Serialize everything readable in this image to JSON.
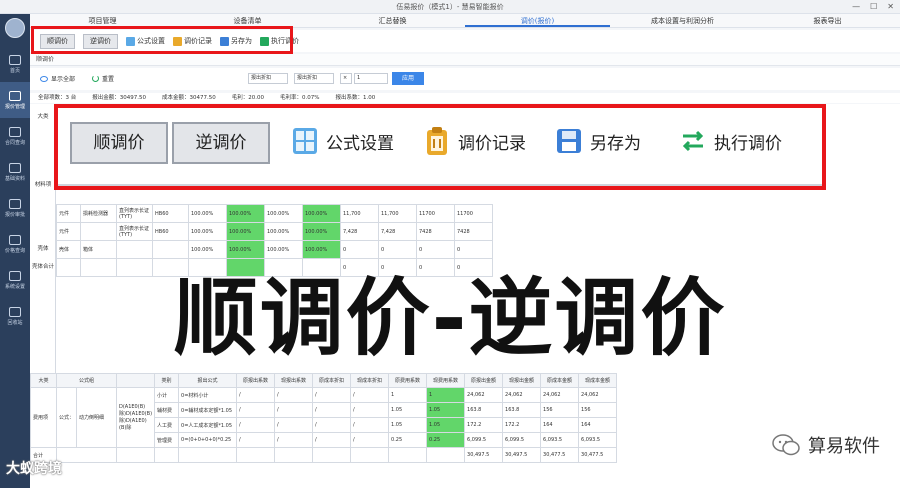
{
  "window": {
    "title": "伍易报价（模式1）- 慧易智能报价",
    "min": "—",
    "max": "☐",
    "close": "✕"
  },
  "sidebar": {
    "items": [
      {
        "label": "首页"
      },
      {
        "label": "报价管理"
      },
      {
        "label": "合同查询"
      },
      {
        "label": "基础资料"
      },
      {
        "label": "报价审批"
      },
      {
        "label": "价格查询"
      },
      {
        "label": "系统设置"
      },
      {
        "label": "回收站"
      }
    ]
  },
  "top_tabs": [
    "项目管理",
    "设备清单",
    "汇总替换",
    "调价(报价)",
    "成本设置与利润分析",
    "报表导出"
  ],
  "toolbar_small": {
    "forward": "顺调价",
    "reverse": "逆调价",
    "formula": "公式设置",
    "record": "调价记录",
    "save_as": "另存为",
    "execute": "执行调价"
  },
  "section_strip": "顺调价",
  "filter_row": {
    "show_all": "显示全部",
    "reset": "重置",
    "select1": "报出折扣",
    "select2": "报出折扣",
    "select3": "×",
    "input_value": "1",
    "apply": "应用"
  },
  "summary": {
    "items": [
      "全部项数：3 台",
      "报出金额：30497.50",
      "成本金额：30477.50",
      "毛利：20.00",
      "毛利率：0.07%",
      "报出系数：1.00"
    ]
  },
  "left_col": [
    "大类",
    "材料项",
    "壳体",
    "壳体合计"
  ],
  "upper_table": {
    "rows": [
      [
        "元件",
        "损耗检测器",
        "直列表示长证(TYT)",
        "HB60",
        "100.00%",
        "100.00%",
        "100.00%",
        "100.00%",
        "11,700",
        "11,700",
        "11700",
        "11700"
      ],
      [
        "元件",
        "",
        "直列表示长证(TYT)",
        "HB60",
        "100.00%",
        "100.00%",
        "100.00%",
        "100.00%",
        "7,428",
        "7,428",
        "7428",
        "7428"
      ],
      [
        "壳体",
        "箱体",
        "",
        "",
        "100.00%",
        "100.00%",
        "100.00%",
        "100.00%",
        "0",
        "0",
        "0",
        "0"
      ],
      [
        "",
        "",
        "",
        "",
        "",
        "",
        "",
        "",
        "0",
        "0",
        "0",
        "0"
      ]
    ]
  },
  "zoom_toolbar": {
    "forward": "顺调价",
    "reverse": "逆调价",
    "formula": "公式设置",
    "record": "调价记录",
    "save_as": "另存为",
    "execute": "执行调价"
  },
  "overlay_title": "顺调价-逆调价",
  "lower_table": {
    "headers": [
      "大类",
      "公式组",
      "",
      "类别",
      "报出公式",
      "原报出系数",
      "现报出系数",
      "原成本折扣",
      "现成本折扣",
      "原费用系数",
      "现费用系数",
      "原报出金额",
      "现报出金额",
      "原成本金额",
      "现成本金额"
    ],
    "rows": [
      [
        "费用项",
        "公式：",
        "动力倒明细",
        "D(A1E0(B)除)D(A1E0(B)除)D(A1E0)(B)除",
        "小计",
        "0=材料小计",
        "/",
        "/",
        "/",
        "/",
        "1",
        "1",
        "24,062",
        "24,062",
        "24,062",
        "24,062"
      ],
      [
        "",
        "",
        "",
        "",
        "辅材费",
        "0=辅材成本定额*1.05",
        "/",
        "/",
        "/",
        "/",
        "1.05",
        "1.05",
        "163.8",
        "163.8",
        "156",
        "156"
      ],
      [
        "",
        "",
        "",
        "",
        "人工费",
        "0=人工成本定额*1.05",
        "/",
        "/",
        "/",
        "/",
        "1.05",
        "1.05",
        "172.2",
        "172.2",
        "164",
        "164"
      ],
      [
        "",
        "",
        "",
        "",
        "管理费",
        "0=(0+0+0+0)*0.25",
        "/",
        "/",
        "/",
        "/",
        "0.25",
        "0.25",
        "6,099.5",
        "6,099.5",
        "6,093.5",
        "6,093.5"
      ],
      [
        "合计",
        "",
        "",
        "",
        "",
        "",
        "",
        "",
        "",
        "",
        "",
        "",
        "30,497.5",
        "30,497.5",
        "30,477.5",
        "30,477.5"
      ]
    ]
  },
  "watermark_left": "大蚁跨境",
  "watermark_right": "算易软件",
  "colors": {
    "accent": "#2f6fd1",
    "highlight_green": "#62d66a",
    "red_frame": "#e8161a",
    "sidebar": "#2b3f5c"
  }
}
